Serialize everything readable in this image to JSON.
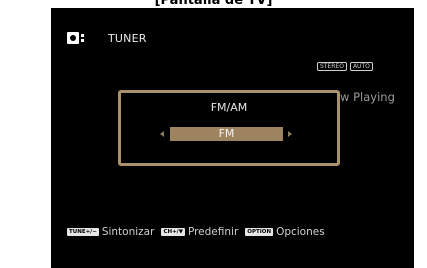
{
  "caption": "[Pantalla de TV]",
  "source": {
    "icon": "radio-icon",
    "label": "TUNER"
  },
  "status_badges": [
    "STEREO",
    "AUTO"
  ],
  "now_playing": "ow Playing",
  "dialog": {
    "title": "FM/AM",
    "value": "FM",
    "left_arrow": "◂",
    "right_arrow": "▸"
  },
  "footer": {
    "hints": [
      {
        "key": "TUNE+/−",
        "label": "Sintonizar"
      },
      {
        "key": "CH+/▼",
        "label": "Predefinir"
      },
      {
        "key": "OPTION",
        "label": "Opciones"
      }
    ]
  },
  "colors": {
    "screen_bg": "#000000",
    "dialog_border": "#a8916b",
    "selection_bg": "#9e8360",
    "text": "#e6e6e6"
  }
}
